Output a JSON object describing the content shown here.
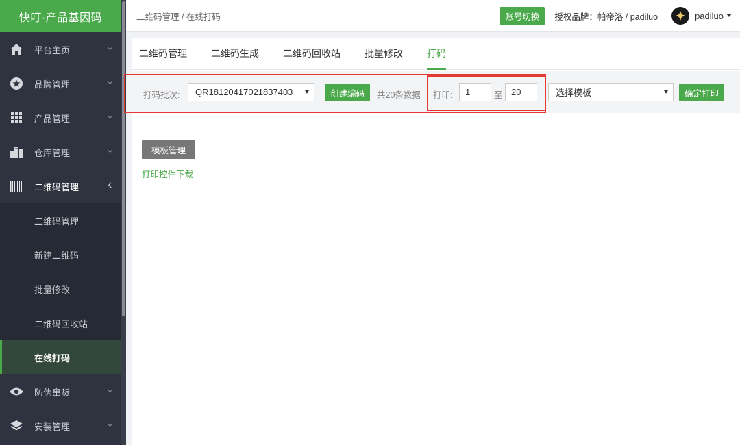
{
  "app": {
    "title": "快叮·产品基因码"
  },
  "sidebar": {
    "items": [
      {
        "label": "平台主页"
      },
      {
        "label": "品牌管理"
      },
      {
        "label": "产品管理"
      },
      {
        "label": "仓库管理"
      },
      {
        "label": "二维码管理"
      },
      {
        "label": "防伪窜货"
      },
      {
        "label": "安装管理"
      }
    ],
    "subitems": [
      {
        "label": "二维码管理"
      },
      {
        "label": "新建二维码"
      },
      {
        "label": "批量修改"
      },
      {
        "label": "二维码回收站"
      },
      {
        "label": "在线打码"
      }
    ]
  },
  "header": {
    "breadcrumb": "二维码管理 / 在线打码",
    "switch_account": "账号切换",
    "brand_info": "授权品牌：帕帝洛 / padiluo",
    "username": "padiluo"
  },
  "tabs": [
    {
      "label": "二维码管理"
    },
    {
      "label": "二维码生成"
    },
    {
      "label": "二维码回收站"
    },
    {
      "label": "批量修改"
    },
    {
      "label": "打码"
    }
  ],
  "toolbar": {
    "batch_label": "打码批次:",
    "batch_value": "QR18120417021837403",
    "create_button": "创建编码",
    "total_text": "共20条数据",
    "print_label": "打印:",
    "from_value": "1",
    "to_label": "至",
    "to_value": "20",
    "template_placeholder": "选择模板",
    "confirm_button": "确定打印"
  },
  "content": {
    "template_button": "模板管理",
    "download_link": "打印控件下载"
  },
  "colors": {
    "accent": "#4aa94a",
    "sidebar": "#2f3340",
    "highlight": "#e53935"
  }
}
